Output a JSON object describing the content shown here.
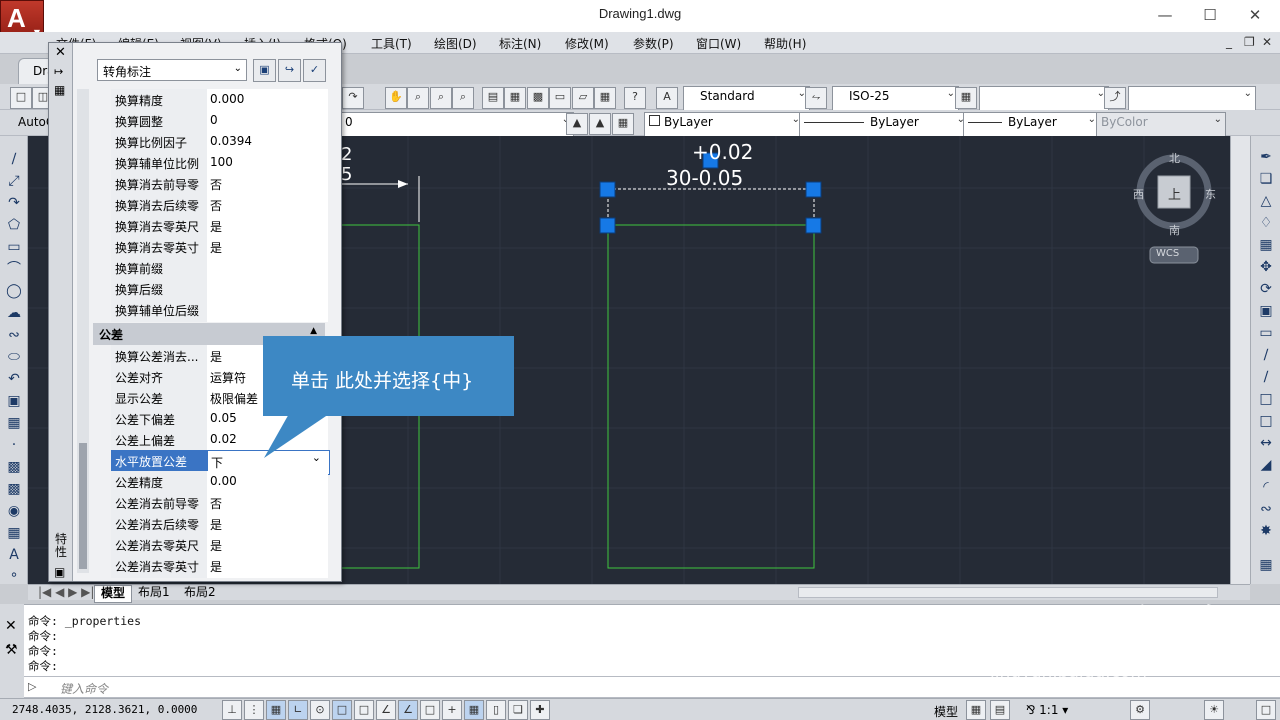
{
  "window": {
    "title": "Drawing1.dwg"
  },
  "menu": [
    "文件(F)",
    "编辑(E)",
    "视图(V)",
    "插入(I)",
    "格式(O)",
    "工具(T)",
    "绘图(D)",
    "标注(N)",
    "修改(M)",
    "参数(P)",
    "窗口(W)",
    "帮助(H)"
  ],
  "tab": {
    "label": "Dra"
  },
  "toolbar": {
    "text_style": "Standard",
    "dim_style": "ISO-25",
    "workspace_label": "AutoC",
    "layer": "0",
    "color": "ByLayer",
    "linetype": "ByLayer",
    "lineweight": "ByLayer",
    "plotstyle": "ByColor"
  },
  "palette": {
    "object_type": "转角标注",
    "rows_alt": [
      {
        "name": "换算精度",
        "value": "0.000"
      },
      {
        "name": "换算圆整",
        "value": "0"
      },
      {
        "name": "换算比例因子",
        "value": "0.0394"
      },
      {
        "name": "换算辅单位比例",
        "value": "100"
      },
      {
        "name": "换算消去前导零",
        "value": "否"
      },
      {
        "name": "换算消去后续零",
        "value": "否"
      },
      {
        "name": "换算消去零英尺",
        "value": "是"
      },
      {
        "name": "换算消去零英寸",
        "value": "是"
      },
      {
        "name": "换算前缀",
        "value": ""
      },
      {
        "name": "换算后缀",
        "value": ""
      },
      {
        "name": "换算辅单位后缀",
        "value": ""
      }
    ],
    "section": "公差",
    "rows_tol": [
      {
        "name": "换算公差消去...",
        "value": "是"
      },
      {
        "name": "公差对齐",
        "value": "运算符"
      },
      {
        "name": "显示公差",
        "value": "极限偏差"
      },
      {
        "name": "公差下偏差",
        "value": "0.05"
      },
      {
        "name": "公差上偏差",
        "value": "0.02"
      },
      {
        "name": "水平放置公差",
        "value": "下"
      },
      {
        "name": "公差精度",
        "value": "0.00"
      },
      {
        "name": "公差消去前导零",
        "value": "否"
      },
      {
        "name": "公差消去后续零",
        "value": "是"
      },
      {
        "name": "公差消去零英尺",
        "value": "是"
      },
      {
        "name": "公差消去零英寸",
        "value": "是"
      }
    ],
    "side_label": "特性"
  },
  "callout": {
    "text": "单击 此处并选择{中}"
  },
  "drawing": {
    "dim_upper": "+0.02",
    "dim_main": "30-0.05",
    "left_frag_1": "2",
    "left_frag_2": "5"
  },
  "viewcube": {
    "north": "北",
    "south": "南",
    "east": "东",
    "west": "西",
    "top": "上",
    "wcs": "WCS"
  },
  "layout_tabs": [
    "模型",
    "布局1",
    "布局2"
  ],
  "command": {
    "lines": [
      "命令: _properties",
      "命令:",
      "命令:",
      "命令:"
    ],
    "placeholder": "键入命令"
  },
  "status": {
    "coords": "2748.4035, 2128.3621, 0.0000",
    "model": "模型",
    "scale": "1:1"
  },
  "watermark": {
    "brand": "Baidu经验",
    "url": "jingyan.baidu.com"
  },
  "colors": {
    "canvas": "#252b36",
    "callout": "#3d88c4",
    "selection": "#3a74c4",
    "grip": "#1679e6",
    "geometry": "#3fc43f"
  }
}
